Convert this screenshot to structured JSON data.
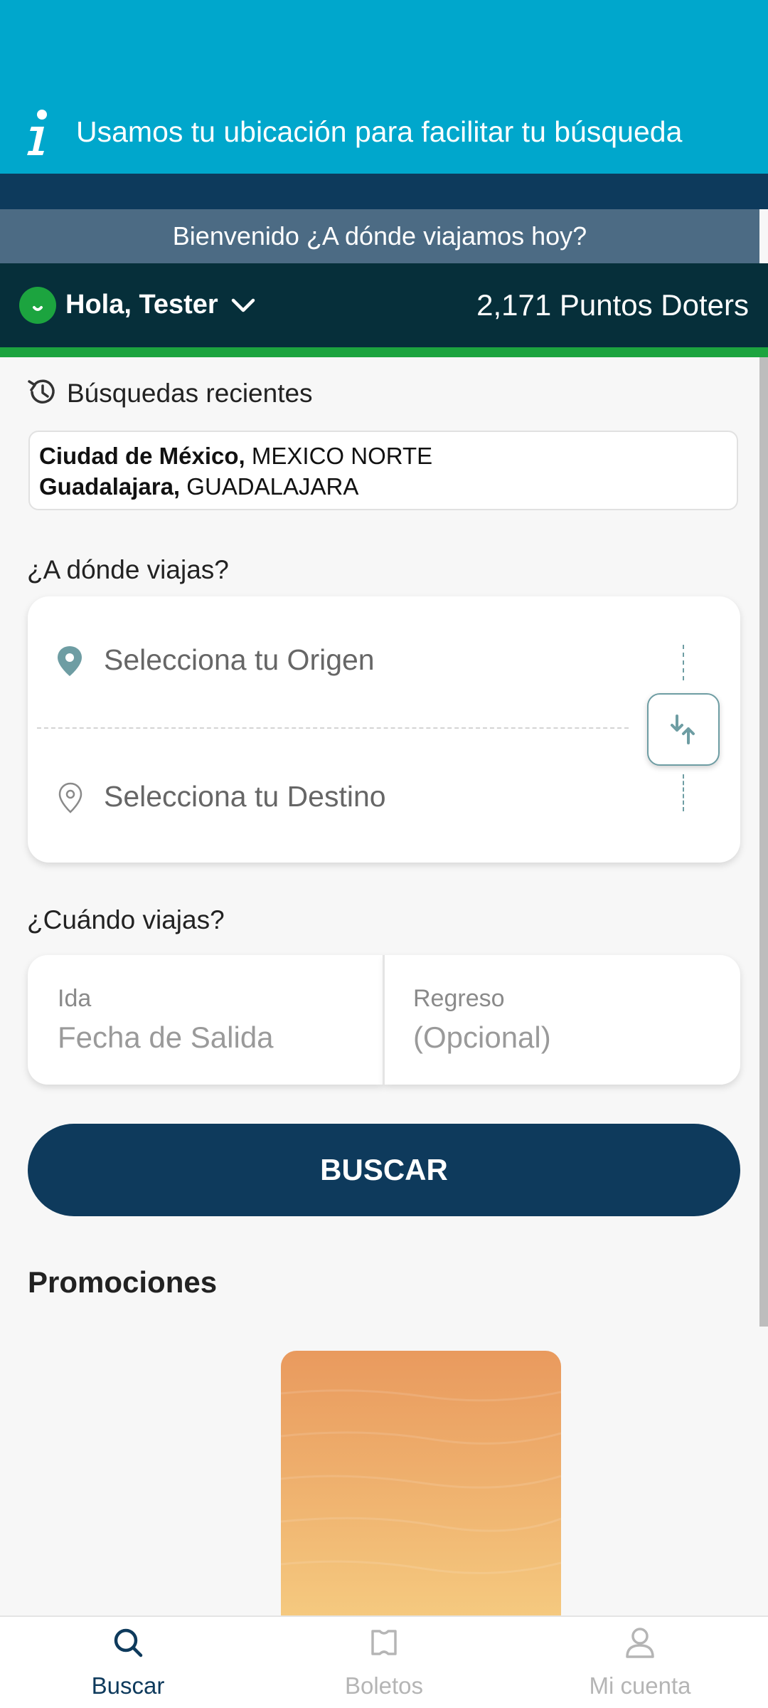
{
  "info_banner": {
    "text": "Usamos tu ubicación para facilitar tu búsqueda"
  },
  "welcome": {
    "text": "Bienvenido ¿A dónde viajamos hoy?"
  },
  "user": {
    "greeting": "Hola, Tester",
    "points": "2,171 Puntos Doters"
  },
  "recent": {
    "title": "Búsquedas recientes",
    "routes": [
      {
        "city": "Ciudad de México,",
        "terminal": " MEXICO NORTE"
      },
      {
        "city": "Guadalajara,",
        "terminal": " GUADALAJARA"
      }
    ]
  },
  "route": {
    "question": "¿A dónde viajas?",
    "origin_placeholder": "Selecciona tu Origen",
    "destination_placeholder": "Selecciona tu Destino"
  },
  "dates": {
    "question": "¿Cuándo viajas?",
    "departure_label": "Ida",
    "departure_placeholder": "Fecha de Salida",
    "return_label": "Regreso",
    "return_placeholder": "(Opcional)"
  },
  "search_button": "BUSCAR",
  "promotions": {
    "title": "Promociones"
  },
  "bottom_nav": [
    {
      "label": "Buscar",
      "icon": "search-icon",
      "active": true
    },
    {
      "label": "Boletos",
      "icon": "ticket-icon",
      "active": false
    },
    {
      "label": "Mi cuenta",
      "icon": "user-icon",
      "active": false
    }
  ],
  "colors": {
    "top_banner": "#00a7cc",
    "navy": "#0e3a5c",
    "user_bar": "#062f3a",
    "green": "#1ca43f",
    "accent_teal": "#6e9da3",
    "nav_active": "#0e3a5c",
    "nav_inactive": "#b5b5b5"
  }
}
